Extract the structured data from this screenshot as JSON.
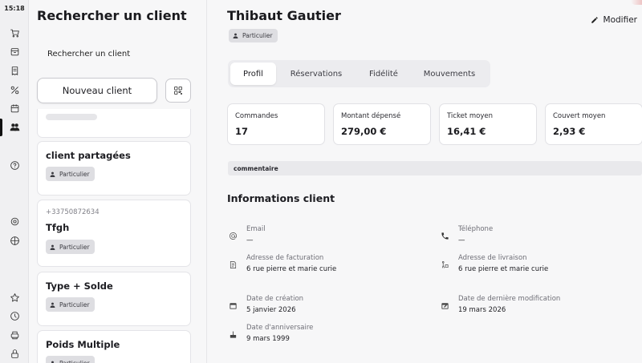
{
  "status_bar": {
    "time": "15:18"
  },
  "nav": {
    "icons": [
      "cart-icon",
      "box-icon",
      "receipt-icon",
      "percent-icon",
      "calendar-icon",
      "customers-icon",
      "help-icon",
      "settings-icon",
      "palette-icon",
      "star-icon",
      "clock-icon",
      "printer-icon",
      "lock-icon"
    ],
    "active": "customers-icon"
  },
  "list": {
    "title": "Rechercher un client",
    "search_label": "Rechercher un client",
    "new_button": "Nouveau client",
    "customers": [
      {
        "phone": "",
        "name": "client partagées",
        "type": "Particulier"
      },
      {
        "phone": "+33750872634",
        "name": "Tfgh",
        "type": "Particulier"
      },
      {
        "phone": "",
        "name": "Type + Solde",
        "type": "Particulier"
      },
      {
        "phone": "",
        "name": "Poids Multiple",
        "type": "Particulier"
      }
    ]
  },
  "client": {
    "name": "Thibaut Gautier",
    "type": "Particulier",
    "edit_label": "Modifier"
  },
  "tabs": [
    {
      "label": "Profil",
      "active": true
    },
    {
      "label": "Réservations",
      "active": false
    },
    {
      "label": "Fidélité",
      "active": false
    },
    {
      "label": "Mouvements",
      "active": false
    }
  ],
  "stats": [
    {
      "label": "Commandes",
      "value": "17"
    },
    {
      "label": "Montant dépensé",
      "value": "279,00 €"
    },
    {
      "label": "Ticket moyen",
      "value": "16,41 €"
    },
    {
      "label": "Couvert moyen",
      "value": "2,93 €"
    }
  ],
  "comment_label": "commentaire",
  "info": {
    "title": "Informations client",
    "email": {
      "label": "Email",
      "value": "—",
      "icon": "at-icon"
    },
    "phone": {
      "label": "Téléphone",
      "value": "—",
      "icon": "phone-icon"
    },
    "billing": {
      "label": "Adresse de facturation",
      "value": "6 rue pierre et marie curie",
      "icon": "billing-address-icon"
    },
    "delivery": {
      "label": "Adresse de livraison",
      "value": "6 rue pierre et marie curie",
      "icon": "delivery-icon"
    },
    "created": {
      "label": "Date de création",
      "value": "5 janvier 2026",
      "icon": "calendar-icon"
    },
    "modified": {
      "label": "Date de dernière modification",
      "value": "19 mars 2026",
      "icon": "calendar-edit-icon"
    },
    "birthday": {
      "label": "Date d'anniversaire",
      "value": "9 mars 1999",
      "icon": "cake-icon"
    }
  }
}
